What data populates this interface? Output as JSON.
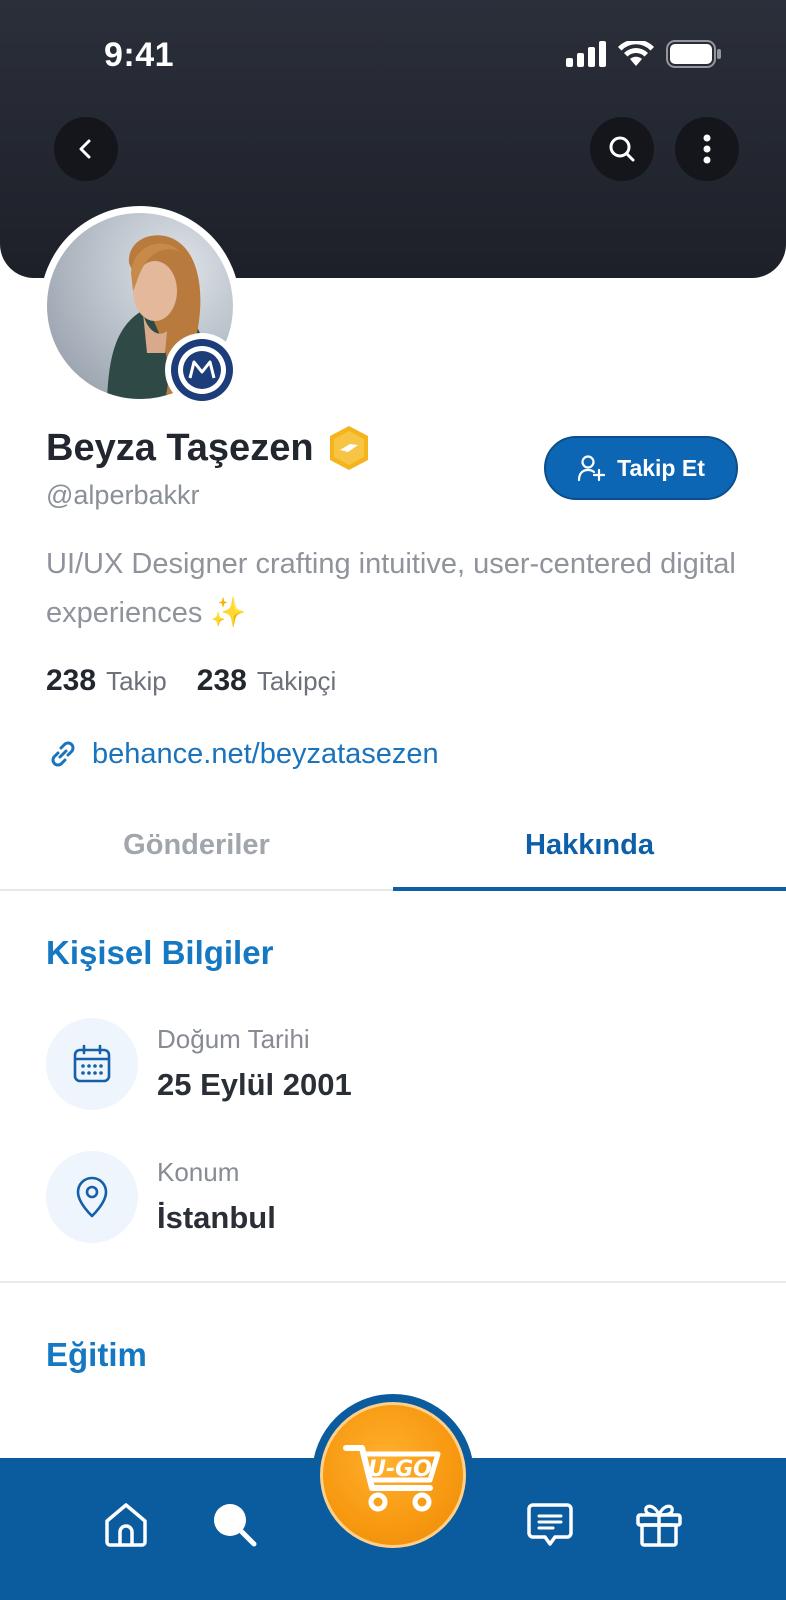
{
  "status_bar": {
    "time": "9:41"
  },
  "profile": {
    "name": "Beyza Taşezen",
    "handle": "@alperbakkr",
    "bio": "UI/UX Designer crafting intuitive, user-centered digital experiences ✨",
    "following_count": "238",
    "following_label": "Takip",
    "followers_count": "238",
    "followers_label": "Takipçi",
    "link": "behance.net/beyzatasezen",
    "follow_button_label": "Takip Et"
  },
  "tabs": [
    {
      "label": "Gönderiler",
      "active": false
    },
    {
      "label": "Hakkında",
      "active": true
    }
  ],
  "personal_info": {
    "title": "Kişisel Bilgiler",
    "items": [
      {
        "label": "Doğum Tarihi",
        "value": "25 Eylül 2001",
        "icon": "calendar-icon"
      },
      {
        "label": "Konum",
        "value": "İstanbul",
        "icon": "location-pin-icon"
      }
    ]
  },
  "education": {
    "title": "Eğitim"
  },
  "bottom_nav": {
    "items": [
      "home-icon",
      "search-icon",
      "cart-logo",
      "messages-icon",
      "gift-icon"
    ],
    "center_logo_text": "U-GO"
  },
  "colors": {
    "header_dark": "#1d2028",
    "primary_blue": "#0c66b4",
    "accent_orange": "#f89a12",
    "verified_gold": "#f5b41b"
  }
}
